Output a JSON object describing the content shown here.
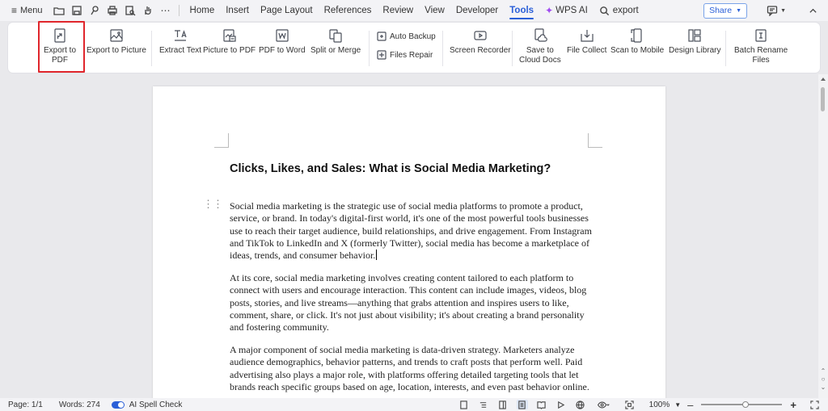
{
  "topbar": {
    "menu_label": "Menu",
    "tabs": [
      {
        "label": "Home"
      },
      {
        "label": "Insert"
      },
      {
        "label": "Page Layout"
      },
      {
        "label": "References"
      },
      {
        "label": "Review"
      },
      {
        "label": "View"
      },
      {
        "label": "Developer"
      },
      {
        "label": "Tools"
      }
    ],
    "active_tab": "Tools",
    "wps_ai_label": "WPS AI",
    "search_label": "export",
    "share_label": "Share",
    "accent_color": "#2a5fd8"
  },
  "ribbon": {
    "buttons": [
      {
        "line1": "Export to",
        "line2": "PDF",
        "icon": "export-pdf-icon"
      },
      {
        "line1": "Export to Picture",
        "line2": "",
        "icon": "export-picture-icon"
      },
      {
        "line1": "Extract Text",
        "line2": "",
        "icon": "extract-text-icon"
      },
      {
        "line1": "Picture to PDF",
        "line2": "",
        "icon": "picture-to-pdf-icon"
      },
      {
        "line1": "PDF to Word",
        "line2": "",
        "icon": "pdf-to-word-icon"
      },
      {
        "line1": "Split or Merge",
        "line2": "",
        "icon": "split-merge-icon"
      },
      {
        "line1": "Screen Recorder",
        "line2": "",
        "icon": "screen-recorder-icon"
      },
      {
        "line1": "Save to",
        "line2": "Cloud Docs",
        "icon": "cloud-docs-icon"
      },
      {
        "line1": "File Collect",
        "line2": "",
        "icon": "file-collect-icon"
      },
      {
        "line1": "Scan to Mobile",
        "line2": "",
        "icon": "scan-mobile-icon"
      },
      {
        "line1": "Design Library",
        "line2": "",
        "icon": "design-library-icon"
      },
      {
        "line1": "Batch Rename",
        "line2": "Files",
        "icon": "batch-rename-icon"
      }
    ],
    "auto_backup_label": "Auto Backup",
    "files_repair_label": "Files Repair"
  },
  "document": {
    "title": "Clicks, Likes, and Sales: What is Social Media Marketing?",
    "paragraphs": [
      "Social media marketing is the strategic use of social media platforms to promote a product, service, or brand. In today's digital-first world, it's one of the most powerful tools businesses use to reach their target audience, build relationships, and drive engagement. From Instagram and TikTok to LinkedIn and X (formerly Twitter), social media has become a marketplace of ideas, trends, and consumer behavior.",
      "At its core, social media marketing involves creating content tailored to each platform to connect with users and encourage interaction. This content can include images, videos, blog posts, stories, and live streams—anything that grabs attention and inspires users to like, comment, share, or click. It's not just about visibility; it's about creating a brand personality and fostering community.",
      "A major component of social media marketing is data-driven strategy. Marketers analyze audience demographics, behavior patterns, and trends to craft posts that perform well. Paid advertising also plays a major role, with platforms offering detailed targeting tools that let brands reach specific groups based on age, location, interests, and even past behavior online."
    ]
  },
  "statusbar": {
    "page": "Page: 1/1",
    "words": "Words: 274",
    "spell_check": "AI Spell Check",
    "zoom": "100%",
    "zoom_level": 0.55
  }
}
